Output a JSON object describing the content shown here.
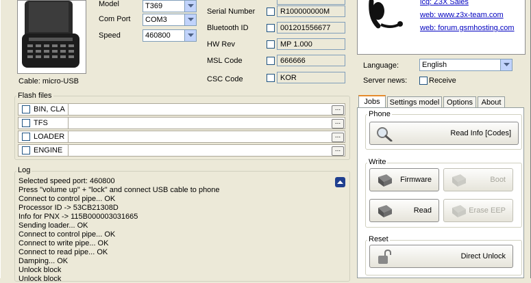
{
  "device": {
    "cable_label": "Cable: micro-USB",
    "model_label": "Model",
    "model_value": "T369",
    "comport_label": "Com Port",
    "comport_value": "COM3",
    "speed_label": "Speed",
    "speed_value": "460800"
  },
  "info": {
    "serial_label": "Serial Number",
    "serial_value": "R100000000M",
    "bt_label": "Bluetooth ID",
    "bt_value": "001201556677",
    "hw_label": "HW Rev",
    "hw_value": "MP 1.000",
    "msl_label": "MSL Code",
    "msl_value": "666666",
    "csc_label": "CSC Code",
    "csc_value": "KOR"
  },
  "links": {
    "icq": "icq: Z3X Sales",
    "web": "web: www.z3x-team.com",
    "forum": "web: forum.gsmhosting.com"
  },
  "settings": {
    "language_label": "Language:",
    "language_value": "English",
    "server_news_label": "Server news:",
    "receive_label": "Receive"
  },
  "flash": {
    "title": "Flash files",
    "rows": [
      "BIN, CLA",
      "TFS",
      "LOADER",
      "ENGINE"
    ],
    "browse": "..."
  },
  "log": {
    "title": "Log",
    "lines": [
      "Selected speed port: 460800",
      "Press \"volume up\" + \"lock\" and connect USB cable to phone",
      "Connect to control pipe... OK",
      "Processor ID -> 53CB21308D",
      "Info for PNX -> 115B000003031665",
      "Sending loader... OK",
      "Connect to control pipe... OK",
      "Connect to write pipe... OK",
      "Connect to read pipe... OK",
      "Damping... OK",
      "Unlock block",
      "Unlock block"
    ]
  },
  "tabs": [
    "Jobs",
    "Settings model",
    "Options",
    "About"
  ],
  "jobs": {
    "phone_group": "Phone",
    "read_info": "Read Info [Codes]",
    "write_group": "Write",
    "firmware": "Firmware",
    "boot": "Boot",
    "read": "Read",
    "erase_eep": "Erase EEP",
    "reset_group": "Reset",
    "direct_unlock": "Direct Unlock"
  },
  "colors": {
    "window_bg": "#ece9d8",
    "link": "#0000c0",
    "tab_accent": "#e68b2c",
    "disabled_text": "#a7a69d"
  }
}
